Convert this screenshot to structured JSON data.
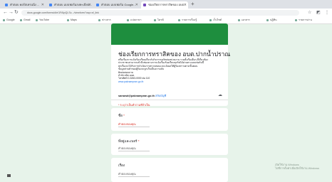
{
  "tabs": [
    {
      "label": "คำตอบ คอร์สเทรนนิ่ง ..."
    },
    {
      "label": "คำตอบ แบบฟอร์มลงทะเบียน..."
    },
    {
      "label": "คำตอบ แบบฟอร์ม Google..."
    },
    {
      "label": "ช่องเรียกการทราสิคของ อบต..."
    }
  ],
  "new_tab": "+",
  "url": "docs.google.com/forms/d/e/1FAIpQLSc.../viewform?usp=sf_link",
  "bookmarks": [
    {
      "label": "Google"
    },
    {
      "label": "Gmail"
    },
    {
      "label": "YouTube"
    },
    {
      "label": "Maps"
    },
    {
      "label": "ข่าวสาร"
    },
    {
      "label": "แปลภาษา"
    },
    {
      "label": "ไดรฟ์"
    },
    {
      "label": "รายการเรื่องรู้"
    },
    {
      "label": "เว็บไซต์"
    },
    {
      "label": "เอกสาร"
    },
    {
      "label": "ปฏิทิน"
    },
    {
      "label": "รายการอ่าน"
    }
  ],
  "form": {
    "title": "ช่องเรียกการทราสิคของ อบต.ปากน้ำปราณ",
    "description_lines": [
      "หรือเรื่องการแจ้ง/ร้องเรียนเกี่ยวกับกิจการทุจริตต่อหน่วยงาน รวมทั้งเรื่องอื่นๆ ที่เกี่ยวข้อง",
      "ประชาชนสามารถเข้าถึงช่องทางการแจ้งเรื่องร้องเรียนทุจริตได้ผ่านทางแบบฟอร์มนี้",
      "ทุกเรื่องจะได้รับการดำเนินการตรวจสอบและแจ้งผลให้ผู้ร้องทราบตามขั้นตอน",
      "ข้อมูลส่วนตัวของผู้ร้องจะถูกเก็บเป็นความลับ",
      "ติดต่อสอบถาม",
      "สำนักปลัด อบต.",
      "โทรศัพท์ 0-3263-0000 ต่อ 110",
      "www.paknampran.go.th"
    ],
    "account": "sarawut@paknampran.go.th",
    "switch_account": "สลับบัญชี",
    "required_note": "* ระบุว่าเป็นคำถามที่จำเป็น",
    "questions": [
      {
        "label": "ชื่อ",
        "value": "คำตอบของคุณ",
        "error": true
      },
      {
        "label": "ที่อยู่และเบอร์",
        "value": "คำตอบของคุณ",
        "error": false
      },
      {
        "label": "เรื่อง",
        "value": "คำตอบของคุณ",
        "error": false
      }
    ]
  },
  "side_text_1": "เปิดใช้งาน Windows",
  "side_text_2": "ไปที่การตั้งค่าเพื่อเปิดใช้งาน Windows"
}
